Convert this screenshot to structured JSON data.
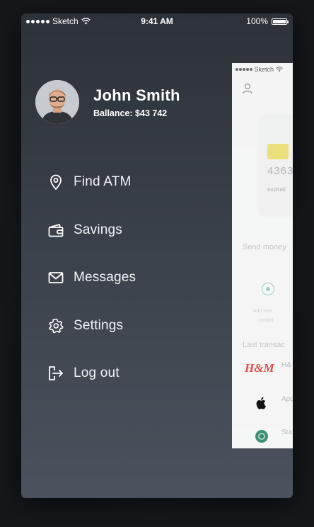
{
  "status_bar": {
    "carrier": "Sketch",
    "time": "9:41 AM",
    "battery": "100%"
  },
  "profile": {
    "name": "John Smith",
    "balance": "Ballance: $43 742"
  },
  "menu": {
    "items": [
      {
        "label": "Find ATM",
        "icon": "location-pin-icon"
      },
      {
        "label": "Savings",
        "icon": "wallet-icon"
      },
      {
        "label": "Messages",
        "icon": "envelope-icon"
      },
      {
        "label": "Settings",
        "icon": "gear-icon"
      },
      {
        "label": "Log out",
        "icon": "logout-icon"
      }
    ]
  },
  "background_app": {
    "status_carrier": "Sketch",
    "card_number_partial": "4363",
    "card_expiration_label": "expirati",
    "send_money_label": "Send money",
    "recipient_label": "Add new",
    "recipient_label_2": "contact",
    "last_transactions_label": "Last transac",
    "transactions": [
      {
        "label": "H&",
        "logo": "H&M"
      },
      {
        "label": "App",
        "logo": "apple-logo-icon"
      },
      {
        "label": "Sta",
        "logo": "starbucks-logo-icon"
      }
    ]
  },
  "colors": {
    "drawer_top": "#2d3239",
    "drawer_bottom": "#4b525d",
    "text": "#ffffff",
    "chip": "#f5e46b",
    "hm_red": "#e2231a",
    "starbucks_green": "#00704a"
  }
}
